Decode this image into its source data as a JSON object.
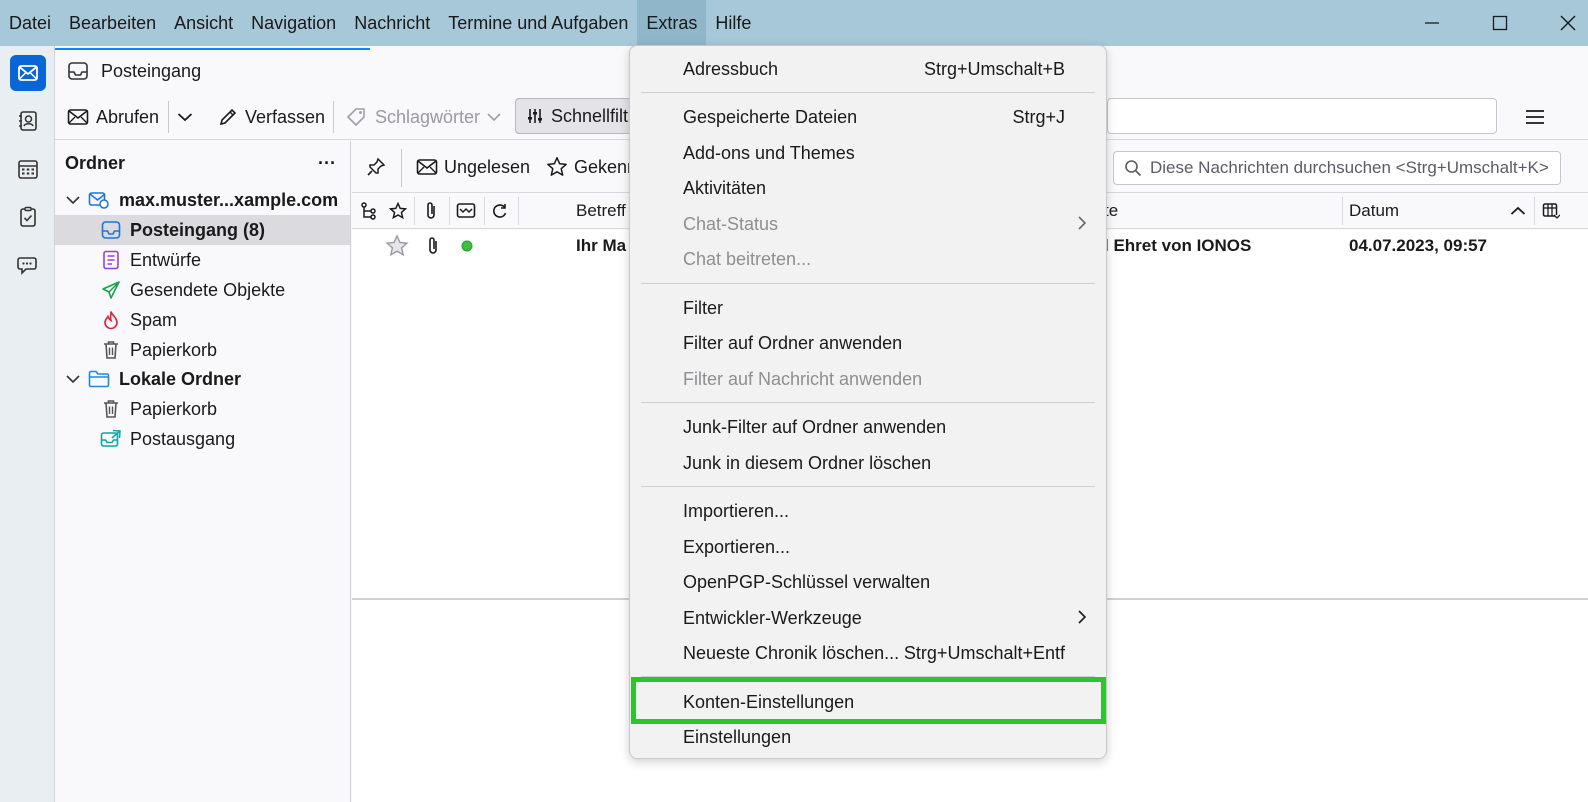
{
  "menubar": {
    "items": [
      "Datei",
      "Bearbeiten",
      "Ansicht",
      "Navigation",
      "Nachricht",
      "Termine und Aufgaben",
      "Extras",
      "Hilfe"
    ],
    "active_index": 6
  },
  "window_controls": {
    "minimize": "—",
    "maximize": "☐",
    "close": "✕"
  },
  "tab": {
    "label": "Posteingang"
  },
  "toolbar": {
    "get_messages": "Abrufen",
    "write": "Verfassen",
    "tags": "Schlagwörter",
    "quick_filter": "Schnellfilt"
  },
  "folder_pane": {
    "header": "Ordner",
    "menu": "···",
    "accounts": [
      {
        "name": "max.muster...xample.com",
        "folders": [
          {
            "label": "Posteingang (8)",
            "icon": "inbox-icon",
            "selected": true
          },
          {
            "label": "Entwürfe",
            "icon": "drafts-icon"
          },
          {
            "label": "Gesendete Objekte",
            "icon": "sent-icon"
          },
          {
            "label": "Spam",
            "icon": "spam-icon"
          },
          {
            "label": "Papierkorb",
            "icon": "trash-icon"
          }
        ]
      },
      {
        "name": "Lokale Ordner",
        "folders": [
          {
            "label": "Papierkorb",
            "icon": "trash-icon"
          },
          {
            "label": "Postausgang",
            "icon": "outbox-icon"
          }
        ]
      }
    ]
  },
  "quick_filter_bar": {
    "unread": "Ungelesen",
    "starred": "Gekenn",
    "search_placeholder": "Diese Nachrichten durchsuchen <Strg+Umschalt+K>"
  },
  "thread_columns": {
    "subject": "Betreff",
    "correspondent": "te",
    "date": "Datum"
  },
  "thread_rows": [
    {
      "subject": "Ihr Ma",
      "correspondent": "l Ehret von IONOS",
      "date": "04.07.2023, 09:57"
    }
  ],
  "extras_menu": {
    "items": [
      {
        "label": "Adressbuch",
        "shortcut": "Strg+Umschalt+B"
      },
      {
        "label": "Gespeicherte Dateien",
        "shortcut": "Strg+J"
      },
      {
        "label": "Add-ons und Themes",
        "shortcut": ""
      },
      {
        "label": "Aktivitäten",
        "shortcut": ""
      },
      {
        "label": "Chat-Status",
        "shortcut": "",
        "disabled": true,
        "submenu": true
      },
      {
        "label": "Chat beitreten...",
        "shortcut": "",
        "disabled": true
      },
      {
        "label": "Filter",
        "shortcut": ""
      },
      {
        "label": "Filter auf Ordner anwenden",
        "shortcut": ""
      },
      {
        "label": "Filter auf Nachricht anwenden",
        "shortcut": "",
        "disabled": true
      },
      {
        "label": "Junk-Filter auf Ordner anwenden",
        "shortcut": ""
      },
      {
        "label": "Junk in diesem Ordner löschen",
        "shortcut": ""
      },
      {
        "label": "Importieren...",
        "shortcut": ""
      },
      {
        "label": "Exportieren...",
        "shortcut": ""
      },
      {
        "label": "OpenPGP-Schlüssel verwalten",
        "shortcut": ""
      },
      {
        "label": "Entwickler-Werkzeuge",
        "shortcut": "",
        "submenu": true
      },
      {
        "label": "Neueste Chronik löschen...",
        "shortcut": "Strg+Umschalt+Entf"
      },
      {
        "label": "Konten-Einstellungen",
        "shortcut": "",
        "highlighted": true
      },
      {
        "label": "Einstellungen",
        "shortcut": ""
      }
    ]
  },
  "colors": {
    "titlebar": "#a6c8d8",
    "accent": "#0a66d6",
    "highlight_box": "#2ec42e"
  }
}
